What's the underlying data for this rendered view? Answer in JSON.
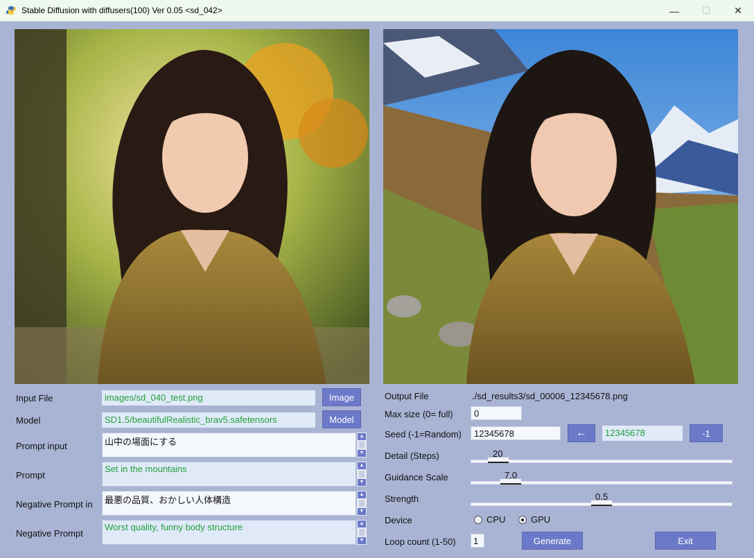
{
  "window": {
    "title": "Stable Diffusion with diffusers(100)  Ver 0.05 <sd_042>",
    "controls": {
      "minimize": "—",
      "maximize": "☐",
      "close": "✕"
    },
    "app_icon": "python-icon"
  },
  "left": {
    "input_file": {
      "label": "Input File",
      "value": "images/sd_040_test.png",
      "button": "Image"
    },
    "model": {
      "label": "Model",
      "value": "SD1.5/beautifulRealistic_brav5.safetensors",
      "button": "Model"
    },
    "prompt_input": {
      "label": "Prompt input",
      "value": "山中の場面にする"
    },
    "prompt": {
      "label": "Prompt",
      "value": "Set in the mountains"
    },
    "neg_prompt_input": {
      "label": "Negative Prompt in",
      "value": "最悪の品質、おかしい人体構造"
    },
    "neg_prompt": {
      "label": "Negative Prompt",
      "value": "Worst quality, funny body structure"
    }
  },
  "right": {
    "output_file": {
      "label": "Output File",
      "value": "./sd_results3/sd_00006_12345678.png"
    },
    "max_size": {
      "label": "Max size (0= full)",
      "value": "0"
    },
    "seed": {
      "label": "Seed  (-1=Random)",
      "value": "12345678",
      "arrow_button": "←",
      "last_seed": "12345678",
      "minus_button": "-1"
    },
    "detail": {
      "label": "Detail (Steps)",
      "value": "20"
    },
    "guidance": {
      "label": "Guidance Scale",
      "value": "7.0"
    },
    "strength": {
      "label": "Strength",
      "value": "0.5"
    },
    "device": {
      "label": "Device",
      "options": [
        "CPU",
        "GPU"
      ],
      "selected": "GPU"
    },
    "loop": {
      "label": "Loop count (1-50)",
      "value": "1"
    },
    "generate_button": "Generate",
    "exit_button": "Exit"
  }
}
